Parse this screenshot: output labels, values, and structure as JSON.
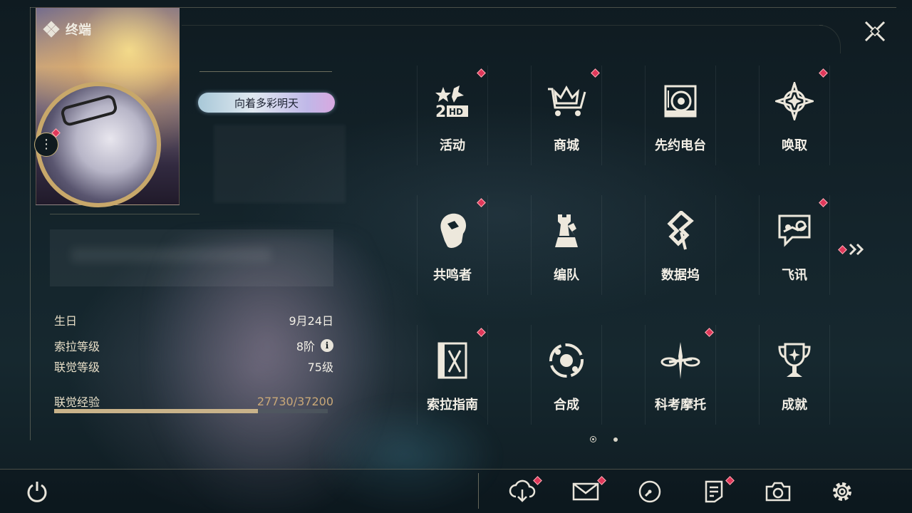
{
  "header": {
    "title": "终端"
  },
  "profile": {
    "title_badge": "向着多彩明天",
    "stats": [
      {
        "label": "生日",
        "value": "9月24日"
      },
      {
        "label": "索拉等级",
        "value": "8阶"
      },
      {
        "label": "联觉等级",
        "value": "75级"
      }
    ],
    "exp": {
      "label": "联觉经验",
      "value_text": "27730/37200",
      "current": 27730,
      "max": 37200
    }
  },
  "menu": {
    "items": [
      {
        "label": "活动",
        "icon": "events-2hd-icon",
        "badge": true
      },
      {
        "label": "商城",
        "icon": "shop-cart-crown-icon",
        "badge": true
      },
      {
        "label": "先约电台",
        "icon": "radio-icon",
        "badge": false
      },
      {
        "label": "唤取",
        "icon": "convene-star-icon",
        "badge": true
      },
      {
        "label": "共鸣者",
        "icon": "resonator-head-icon",
        "badge": true
      },
      {
        "label": "编队",
        "icon": "chess-team-icon",
        "badge": false
      },
      {
        "label": "数据坞",
        "icon": "data-bank-icon",
        "badge": false
      },
      {
        "label": "飞讯",
        "icon": "chat-bubble-icon",
        "badge": true
      },
      {
        "label": "索拉指南",
        "icon": "guidebook-icon",
        "badge": true
      },
      {
        "label": "合成",
        "icon": "synthesis-icon",
        "badge": false
      },
      {
        "label": "科考摩托",
        "icon": "motorcycle-icon",
        "badge": true
      },
      {
        "label": "成就",
        "icon": "trophy-icon",
        "badge": false
      }
    ],
    "page_count": 2,
    "current_page": 1
  },
  "bottom_bar": {
    "icons": [
      "power-icon",
      "download-icon",
      "mail-icon",
      "clock-icon",
      "notice-icon",
      "camera-icon",
      "settings-gear-icon"
    ]
  },
  "colors": {
    "accent": "#c9b38a",
    "badge": "#e0385a",
    "background": "#14242b"
  }
}
